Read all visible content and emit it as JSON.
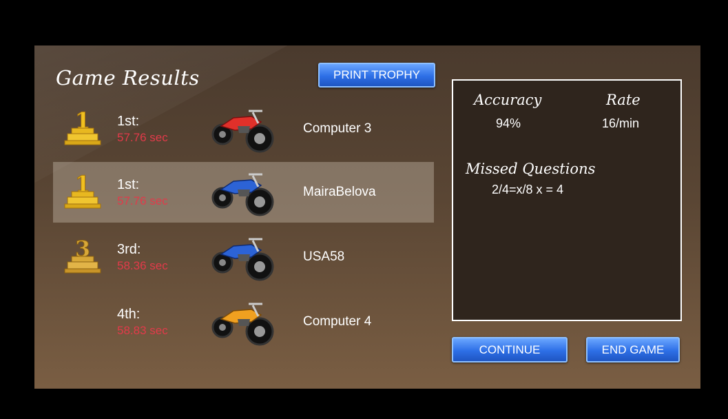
{
  "title": "Game Results",
  "buttons": {
    "print_trophy": "PRINT TROPHY",
    "continue": "CONTINUE",
    "end_game": "END GAME"
  },
  "results": [
    {
      "place": "1st:",
      "time": "57.76 sec",
      "player": "Computer 3",
      "trophy": "1",
      "bike_color": "#e0302a",
      "highlight": false
    },
    {
      "place": "1st:",
      "time": "57.76 sec",
      "player": "MairaBelova",
      "trophy": "1",
      "bike_color": "#2c63d6",
      "highlight": true
    },
    {
      "place": "3rd:",
      "time": "58.36 sec",
      "player": "USA58",
      "trophy": "3",
      "bike_color": "#2c63d6",
      "highlight": false
    },
    {
      "place": "4th:",
      "time": "58.83 sec",
      "player": "Computer 4",
      "trophy": "",
      "bike_color": "#f0a020",
      "highlight": false
    }
  ],
  "stats": {
    "accuracy_label": "Accuracy",
    "accuracy_value": "94%",
    "rate_label": "Rate",
    "rate_value": "16/min",
    "missed_label": "Missed Questions",
    "missed_items": [
      "2/4=x/8 x = 4"
    ]
  },
  "colors": {
    "button_blue": "#2d6fe6",
    "time_red": "#e23a4a",
    "trophy_gold": "#e8b820"
  }
}
